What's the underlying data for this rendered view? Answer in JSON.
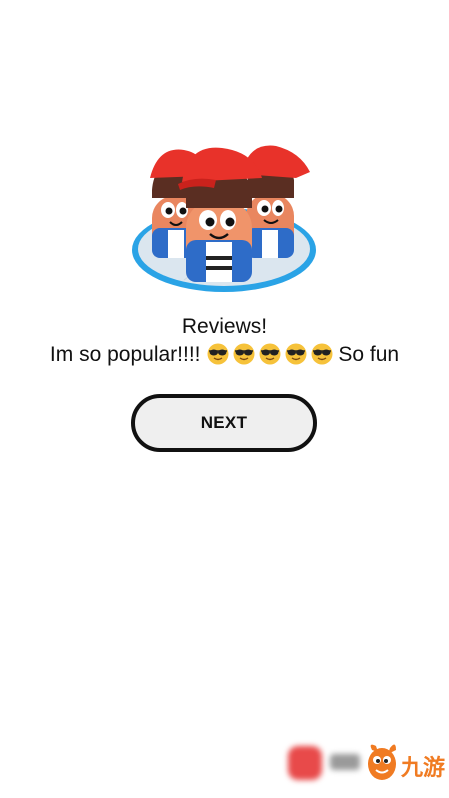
{
  "dialog": {
    "title": "Reviews!",
    "message_prefix": "Im so popular!!!!",
    "emoji": [
      "😎",
      "😎",
      "😎",
      "😎",
      "😎"
    ],
    "message_suffix": "So fun",
    "next_label": "NEXT"
  },
  "illustration": {
    "icon": "three-cartoon-characters-with-red-caps-icon",
    "cap_color": "#e8322a",
    "disc_color": "#2aa3e6"
  },
  "watermark": {
    "brand_text": "九游",
    "brand_color": "#f07b22",
    "icon": "nine-game-mascot-icon"
  }
}
